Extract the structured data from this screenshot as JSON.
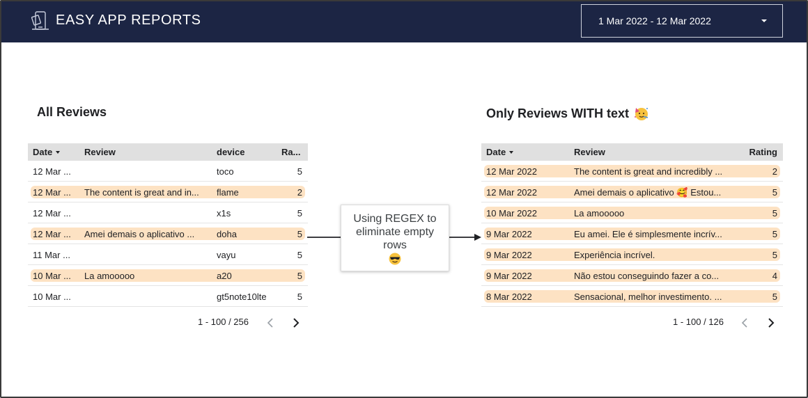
{
  "header": {
    "brand": "EASY APP REPORTS",
    "date_range": "1 Mar 2022 - 12 Mar 2022"
  },
  "left": {
    "title": "All Reviews",
    "columns": [
      "Date",
      "Review",
      "device",
      "Ra..."
    ],
    "rows": [
      {
        "date": "12 Mar ...",
        "review": "",
        "device": "toco",
        "rating": "5",
        "highlight": false
      },
      {
        "date": "12 Mar ...",
        "review": "The content is great and in...",
        "device": "flame",
        "rating": "2",
        "highlight": true
      },
      {
        "date": "12 Mar ...",
        "review": "",
        "device": "x1s",
        "rating": "5",
        "highlight": false
      },
      {
        "date": "12 Mar ...",
        "review": "Amei demais o aplicativo ...",
        "device": "doha",
        "rating": "5",
        "highlight": true
      },
      {
        "date": "11 Mar ...",
        "review": "",
        "device": "vayu",
        "rating": "5",
        "highlight": false
      },
      {
        "date": "10 Mar ...",
        "review": "La amooooo",
        "device": "a20",
        "rating": "5",
        "highlight": true
      },
      {
        "date": "10 Mar ...",
        "review": "",
        "device": "gt5note10lte",
        "rating": "5",
        "highlight": false
      }
    ],
    "pagination": "1 - 100 / 256"
  },
  "callout": {
    "line1": "Using REGEX to",
    "line2": "eliminate empty",
    "line3": "rows"
  },
  "right": {
    "title": "Only Reviews WITH text",
    "columns": [
      "Date",
      "Review",
      "Rating"
    ],
    "rows": [
      {
        "date": "12 Mar 2022",
        "review": "The content is great and incredibly ...",
        "rating": "2"
      },
      {
        "date": "12 Mar 2022",
        "review": "Amei demais o aplicativo 🥰 Estou...",
        "rating": "5"
      },
      {
        "date": "10 Mar 2022",
        "review": "La amooooo",
        "rating": "5"
      },
      {
        "date": "9 Mar 2022",
        "review": "Eu amei. Ele é simplesmente incrív...",
        "rating": "5"
      },
      {
        "date": "9 Mar 2022",
        "review": "Experiência incrível.",
        "rating": "5"
      },
      {
        "date": "9 Mar 2022",
        "review": "Não estou conseguindo fazer a co...",
        "rating": "4"
      },
      {
        "date": "8 Mar 2022",
        "review": "Sensacional, melhor investimento. ...",
        "rating": "5"
      }
    ],
    "pagination": "1 - 100 / 126"
  },
  "colors": {
    "header_bg": "#1c2544",
    "row_highlight": "#fde2c3",
    "table_header_bg": "#e0e0e0"
  },
  "icons": {
    "logo": "phone-report-icon",
    "date_caret": "caret-down-icon",
    "sort": "sort-desc-icon",
    "title_emoji": "party-face-icon",
    "callout_emoji": "sunglasses-face-icon",
    "pager_prev": "chevron-left-icon",
    "pager_next": "chevron-right-icon"
  }
}
